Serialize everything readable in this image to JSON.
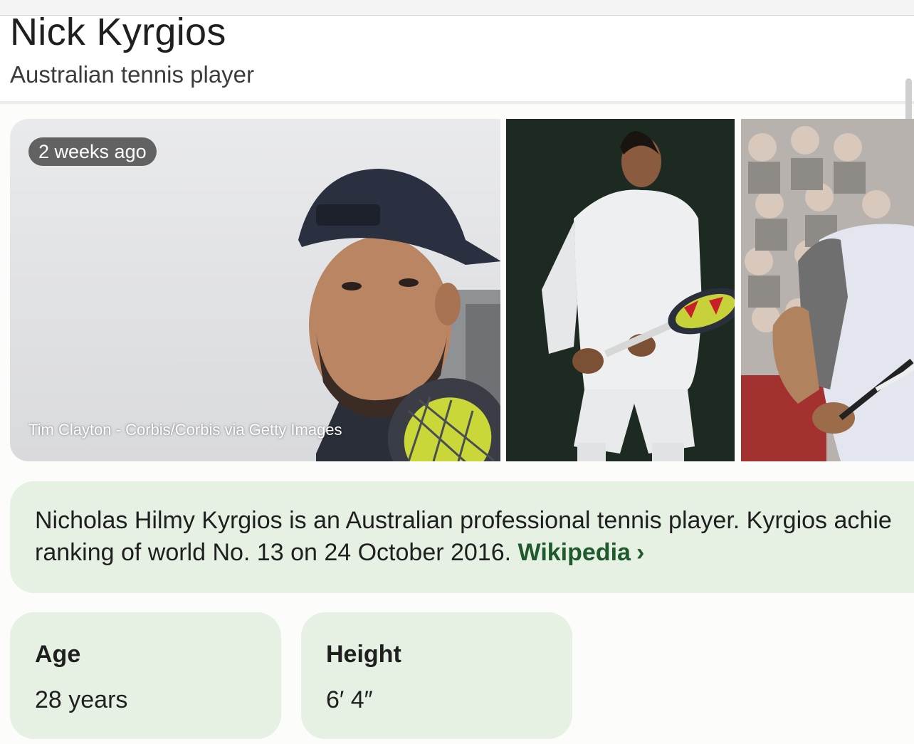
{
  "header": {
    "title": "Nick Kyrgios",
    "subtitle": "Australian tennis player"
  },
  "gallery": {
    "featured": {
      "time_badge": "2 weeks ago",
      "credit": "Tim Clayton - Corbis/Corbis via Getty Images"
    }
  },
  "description": {
    "text": "Nicholas Hilmy Kyrgios is an Australian professional tennis player. Kyrgios achie",
    "text_line2": "ranking of world No. 13 on 24 October 2016.",
    "link_label": "Wikipedia",
    "link_chevron": "›"
  },
  "facts": [
    {
      "label": "Age",
      "value": "28 years"
    },
    {
      "label": "Height",
      "value": "6′ 4″"
    }
  ],
  "colors": {
    "card_background": "#e6f1e4",
    "link": "#1e5a2c"
  }
}
